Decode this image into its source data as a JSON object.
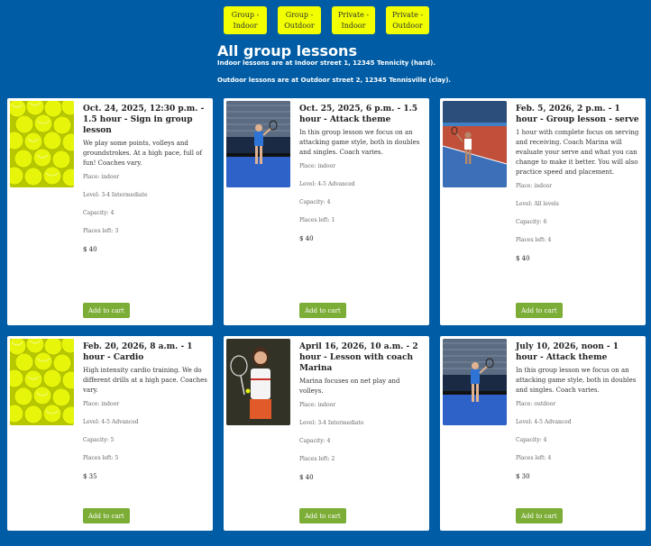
{
  "nav": [
    {
      "label": "Group - Indoor"
    },
    {
      "label": "Group - Outdoor"
    },
    {
      "label": "Private - Indoor"
    },
    {
      "label": "Private - Outdoor"
    }
  ],
  "header": {
    "title": "All group lessons",
    "indoor_note": "Indoor lessons are at Indoor street 1, 12345 Tennicity (hard).",
    "outdoor_note": "Outdoor lessons are at Outdoor street 2, 12345 Tennisville (clay)."
  },
  "cart_label": "Add to cart",
  "lessons": [
    {
      "title": "Oct. 24, 2025, 12:30 p.m. - 1.5 hour - Sign in group lesson",
      "desc": "We play some points, volleys and groundstrokes. At a high pace, full of fun! Coaches vary.",
      "place": "Place: indoor",
      "level": "Level: 3-4 Intermediate",
      "capacity": "Capacity: 4",
      "left": "Places left: 3",
      "price": "$ 40",
      "image": "tennis-balls-image"
    },
    {
      "title": "Oct. 25, 2025, 6 p.m. - 1.5 hour - Attack theme",
      "desc": "In this group lesson we focus on an attacking game style, both in doubles and singles. Coach varies.",
      "place": "Place: indoor",
      "level": "Level: 4-5 Advanced",
      "capacity": "Capacity: 4",
      "left": "Places left: 1",
      "price": "$ 40",
      "image": "player-net-image"
    },
    {
      "title": "Feb. 5, 2026, 2 p.m. - 1 hour - Group lesson - serve",
      "desc": "1 hour with complete focus on serving and receiving. Coach Marina will evaluate your serve and what you can change to make it better. You will also practice speed and placement.",
      "place": "Place: indoor",
      "level": "Level: All levels",
      "capacity": "Capacity: 6",
      "left": "Places left: 4",
      "price": "$ 40",
      "image": "serve-court-image"
    },
    {
      "title": "Feb. 20, 2026, 8 a.m. - 1 hour - Cardio",
      "desc": "High intensity cardio training. We do different drills at a high pace. Coaches vary.",
      "place": "Place: indoor",
      "level": "Level: 4-5 Advanced",
      "capacity": "Capacity: 5",
      "left": "Places left: 5",
      "price": "$ 35",
      "image": "tennis-balls-image"
    },
    {
      "title": "April 16, 2026, 10 a.m. - 2 hour - Lesson with coach Marina",
      "desc": "Marina focuses on net play and volleys.",
      "place": "Place: indoor",
      "level": "Level: 3-4 Intermediate",
      "capacity": "Capacity: 4",
      "left": "Places left: 2",
      "price": "$ 40",
      "image": "coach-portrait-image"
    },
    {
      "title": "July 10, 2026, noon - 1 hour - Attack theme",
      "desc": "In this group lesson we focus on an attacking game style, both in doubles and singles. Coach varies.",
      "place": "Place: outdoor",
      "level": "Level: 4-5 Advanced",
      "capacity": "Capacity: 4",
      "left": "Places left: 4",
      "price": "$ 30",
      "image": "player-net-image"
    }
  ]
}
